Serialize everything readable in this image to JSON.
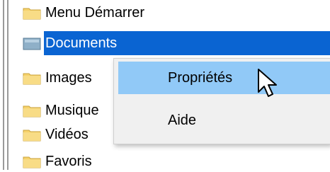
{
  "tree": {
    "items": [
      {
        "label": "Menu Démarrer",
        "icon": "folder-icon"
      },
      {
        "label": "Documents",
        "icon": "library-folder-icon",
        "selected": true
      },
      {
        "label": "Images",
        "icon": "folder-icon"
      },
      {
        "label": "Musique",
        "icon": "folder-icon"
      },
      {
        "label": "Vidéos",
        "icon": "folder-icon"
      },
      {
        "label": "Favoris",
        "icon": "folder-icon"
      }
    ]
  },
  "context_menu": {
    "items": [
      {
        "label": "Propriétés",
        "hovered": true
      },
      {
        "label": "Aide",
        "hovered": false
      }
    ]
  },
  "colors": {
    "selection": "#0a64d2",
    "menu_hover": "#91c9f7",
    "menu_background": "#f0f0f0",
    "folder_yellow": "#f6d26b"
  }
}
